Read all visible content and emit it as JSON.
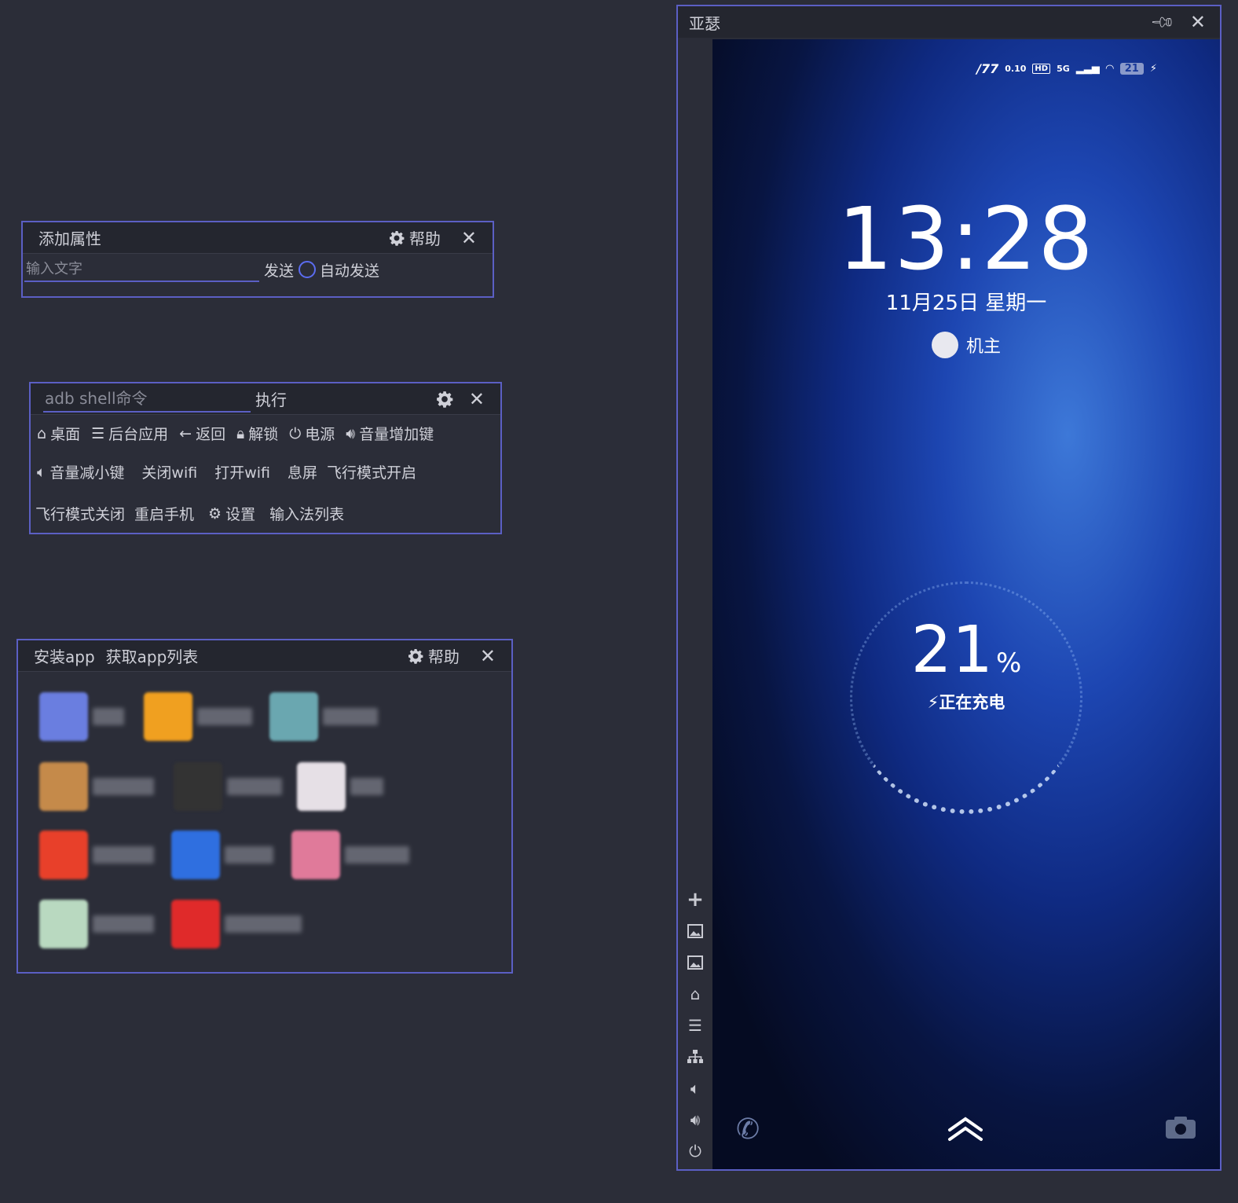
{
  "attr_panel": {
    "title": "添加属性",
    "help_label": "帮助",
    "input_placeholder": "输入文字",
    "send_label": "发送",
    "auto_send_label": "自动发送"
  },
  "shell_panel": {
    "input_placeholder": "adb shell命令",
    "exec_label": "执行",
    "buttons_row1": [
      "桌面",
      "后台应用",
      "返回",
      "解锁",
      "电源",
      "音量增加键"
    ],
    "buttons_row2": [
      "音量减小键",
      "关闭wifi",
      "打开wifi",
      "息屏",
      "飞行模式开启"
    ],
    "buttons_row3": [
      "飞行模式关闭",
      "重启手机",
      "设置",
      "输入法列表"
    ]
  },
  "apps_panel": {
    "install_label": "安装app",
    "list_label": "获取app列表",
    "help_label": "帮助",
    "apps": [
      {
        "color": "#6a7ee0"
      },
      {
        "color": "#f0a020"
      },
      {
        "color": "#6aa7b0"
      },
      {
        "color": "#c58a4a"
      },
      {
        "color": "#333333"
      },
      {
        "color": "#e6e0e6"
      },
      {
        "color": "#e8402a"
      },
      {
        "color": "#2f6fe0"
      },
      {
        "color": "#e07a9a"
      },
      {
        "color": "#b9d9c0"
      },
      {
        "color": "#e02a2a"
      }
    ]
  },
  "phone_window": {
    "title": "亚瑟",
    "status_bar": {
      "speed": "0.10",
      "network": "5G",
      "battery": "21"
    },
    "time": "13:28",
    "date": "11月25日 星期一",
    "owner": "机主",
    "battery_percent": "21",
    "percent_sign": "%",
    "charging_text": "正在充电"
  }
}
